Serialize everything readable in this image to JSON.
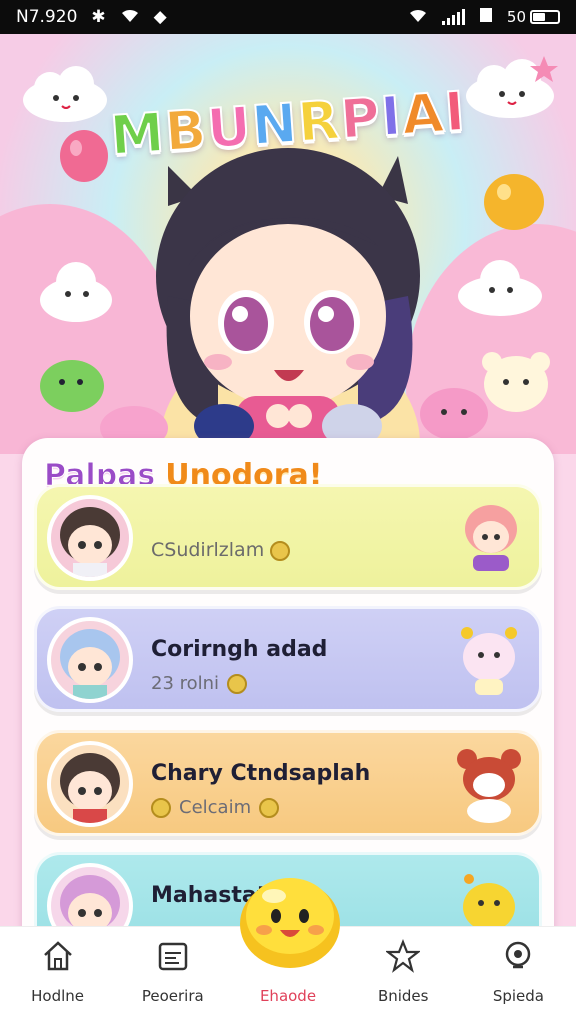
{
  "status_bar": {
    "time": "N7.920",
    "battery_label": "50"
  },
  "app": {
    "title_letters": [
      "M",
      "B",
      "U",
      "N",
      "R",
      "P",
      "I",
      "A",
      "I"
    ],
    "title_colors": [
      "#6fcf4a",
      "#f2a93b",
      "#f46db0",
      "#5aa9f0",
      "#f5d13c",
      "#ef6f98",
      "#7f70e8",
      "#f08a2a",
      "#f25b7a"
    ]
  },
  "section": {
    "heading_part1": "Palpas",
    "heading_part2": "Unodora!"
  },
  "cards": [
    {
      "title": "CSudirlzlam",
      "subtitle": ""
    },
    {
      "title": "Corirngh adad",
      "subtitle": "23 rolni"
    },
    {
      "title": "Chary Ctndsaplah",
      "subtitle": "Celcaim"
    },
    {
      "title": "Mahastatio",
      "subtitle": ""
    }
  ],
  "nav": {
    "items": [
      {
        "label": "Hodlne",
        "icon": "home-icon"
      },
      {
        "label": "Peoerira",
        "icon": "calendar-icon"
      },
      {
        "label": "Ehaode",
        "icon": "mascot-icon"
      },
      {
        "label": "Bnides",
        "icon": "star-icon"
      },
      {
        "label": "Spieda",
        "icon": "search-icon"
      }
    ],
    "active_index": 2
  },
  "colors": {
    "status_bar": "#0c0c0c",
    "accent_active": "#e0415a",
    "card_yellow": "#f5f6b0",
    "card_lavender": "#cfd0f5",
    "card_orange": "#fbd79e",
    "card_teal": "#aee9ec"
  }
}
